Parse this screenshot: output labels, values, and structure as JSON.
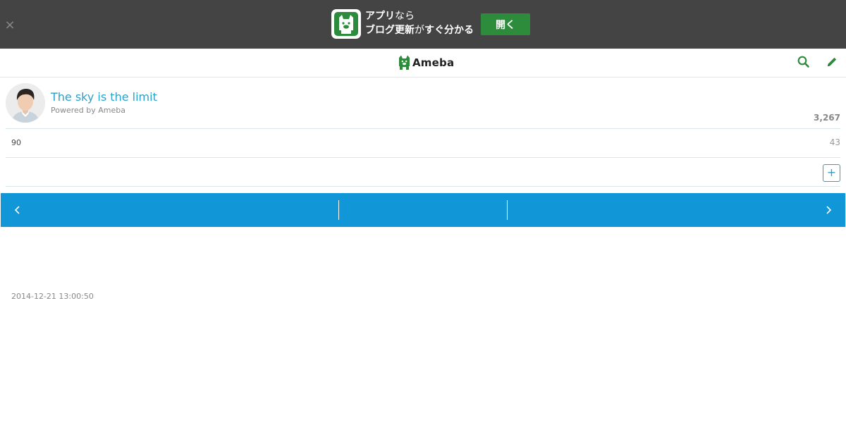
{
  "banner": {
    "close_label": "×",
    "line1_bold": "アプリ",
    "line1_thin": "なら",
    "line2_bold1": "ブログ更新",
    "line2_thin": "が",
    "line2_bold2": "すぐ分かる",
    "open_label": "開く",
    "icon": "ameba-app-icon"
  },
  "header": {
    "logo_text": "Ameba",
    "search_icon": "search-icon",
    "edit_icon": "pencil-icon",
    "brand_color": "#2d8c3c"
  },
  "profile": {
    "title": "The sky is the limit",
    "powered_by": "Powered by Ameba",
    "reader_count": "3,267",
    "avatar": "avatar"
  },
  "stats": {
    "left_value": "90",
    "right_value": "43"
  },
  "follow": {
    "plus_label": "+"
  },
  "pager": {
    "prev_icon": "chevron-left-icon",
    "next_icon": "chevron-right-icon",
    "color": "#1196d8"
  },
  "entry": {
    "timestamp": "2014-12-21 13:00:50"
  }
}
